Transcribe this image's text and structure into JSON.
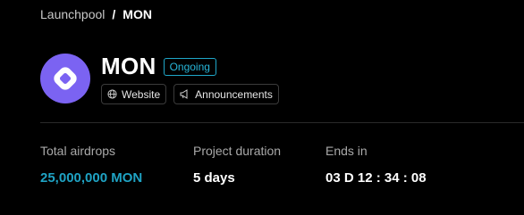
{
  "breadcrumb": {
    "parent": "Launchpool",
    "separator": "/",
    "current": "MON"
  },
  "project": {
    "name": "MON",
    "status": "Ongoing",
    "logo_icon": "diamond-ring-icon",
    "logo_color": "#7b63f2"
  },
  "links": {
    "website": {
      "label": "Website",
      "icon": "globe-icon"
    },
    "announcements": {
      "label": "Announcements",
      "icon": "megaphone-icon"
    }
  },
  "stats": {
    "total_airdrops": {
      "label": "Total airdrops",
      "value": "25,000,000 MON"
    },
    "project_duration": {
      "label": "Project duration",
      "value": "5 days"
    },
    "ends_in": {
      "label": "Ends in",
      "value": "03 D 12 : 34 : 08"
    }
  },
  "colors": {
    "background": "#000000",
    "accent": "#1fa3c4",
    "badge_border": "#1fa7c9"
  }
}
